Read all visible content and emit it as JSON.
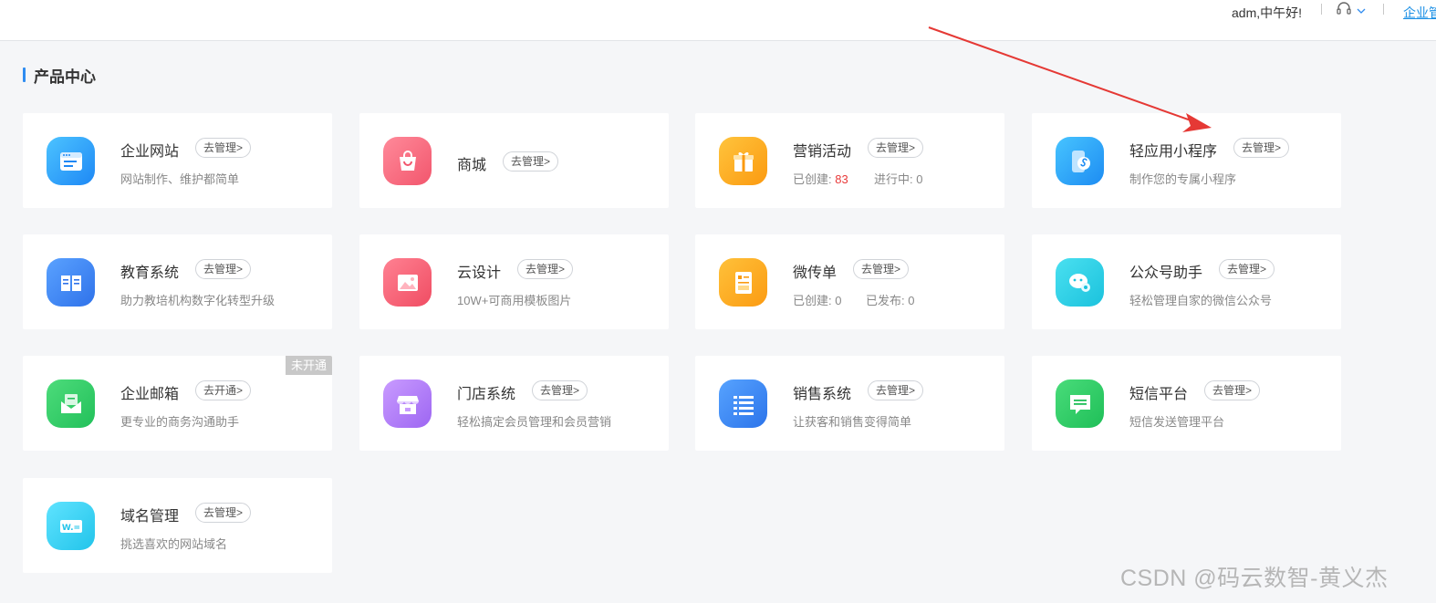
{
  "topbar": {
    "greeting": "adm,中午好!",
    "link": "企业管理"
  },
  "section": {
    "title": "产品中心"
  },
  "cards": {
    "website": {
      "title": "企业网站",
      "button": "去管理>",
      "subtitle": "网站制作、维护都简单"
    },
    "mall": {
      "title": "商城",
      "button": "去管理>"
    },
    "marketing": {
      "title": "营销活动",
      "button": "去管理>",
      "created_label": "已创建:",
      "created_value": "83",
      "running_label": "进行中:",
      "running_value": "0"
    },
    "miniapp": {
      "title": "轻应用小程序",
      "button": "去管理>",
      "subtitle": "制作您的专属小程序"
    },
    "education": {
      "title": "教育系统",
      "button": "去管理>",
      "subtitle": "助力教培机构数字化转型升级"
    },
    "design": {
      "title": "云设计",
      "button": "去管理>",
      "subtitle": "10W+可商用模板图片"
    },
    "flyer": {
      "title": "微传单",
      "button": "去管理>",
      "created_label": "已创建:",
      "created_value": "0",
      "published_label": "已发布:",
      "published_value": "0"
    },
    "wechat": {
      "title": "公众号助手",
      "button": "去管理>",
      "subtitle": "轻松管理自家的微信公众号"
    },
    "email": {
      "title": "企业邮箱",
      "button": "去开通>",
      "subtitle": "更专业的商务沟通助手",
      "badge": "未开通"
    },
    "store": {
      "title": "门店系统",
      "button": "去管理>",
      "subtitle": "轻松搞定会员管理和会员营销"
    },
    "sales": {
      "title": "销售系统",
      "button": "去管理>",
      "subtitle": "让获客和销售变得简单"
    },
    "sms": {
      "title": "短信平台",
      "button": "去管理>",
      "subtitle": "短信发送管理平台"
    },
    "domain": {
      "title": "域名管理",
      "button": "去管理>",
      "subtitle": "挑选喜欢的网站域名",
      "icon_text": "W.="
    }
  },
  "colors": {
    "accent": "#2f8cf0",
    "annotation_arrow": "#e53935",
    "stat_highlight": "#e83a3a"
  },
  "icons": [
    "browser-icon",
    "shopping-bag-icon",
    "gift-icon",
    "mini-program-icon",
    "book-icon",
    "image-icon",
    "document-icon",
    "chat-bubbles-icon",
    "envelope-icon",
    "storefront-icon",
    "list-icon",
    "message-icon",
    "domain-icon",
    "headset-icon",
    "chevron-down-icon"
  ],
  "watermark": "CSDN @码云数智-黄义杰"
}
